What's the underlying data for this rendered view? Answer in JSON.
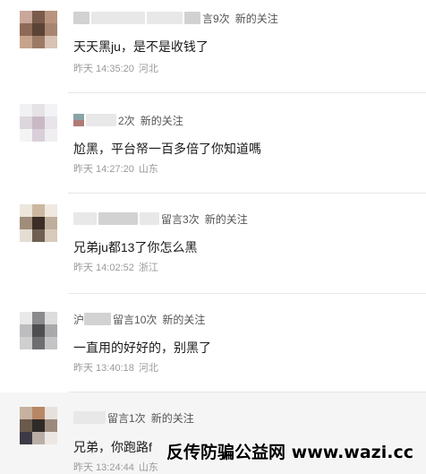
{
  "comments": [
    {
      "meta_suffix": "言9次",
      "tag": "新的关注",
      "text": "天天黑ju，是不是收钱了",
      "time": "昨天 14:35:20",
      "location": "河北"
    },
    {
      "meta_suffix": "2次",
      "tag": "新的关注",
      "text": "尬黑，平台帑一百多倍了你知道嗎",
      "time": "昨天 14:27:20",
      "location": "山东"
    },
    {
      "meta_suffix": "留言3次",
      "tag": "新的关注",
      "text": "兄弟ju都13了你怎么黑",
      "time": "昨天 14:02:52",
      "location": "浙江"
    },
    {
      "meta_prefix": "沪",
      "meta_suffix": "留言10次",
      "tag": "新的关注",
      "text": "一直用的好好的，别黑了",
      "time": "昨天 13:40:18",
      "location": "河北"
    },
    {
      "meta_suffix": "留言1次",
      "tag": "新的关注",
      "text": "兄弟，你跑路f",
      "time": "昨天 13:24:44",
      "location": "山东"
    }
  ],
  "watermark": "反传防骗公益网 www.wazi.cc"
}
